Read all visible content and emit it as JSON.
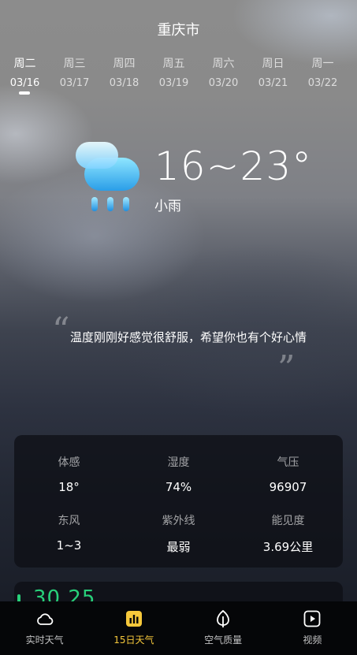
{
  "header": {
    "city": "重庆市"
  },
  "days": [
    {
      "weekday": "周二",
      "date": "03/16",
      "active": true
    },
    {
      "weekday": "周三",
      "date": "03/17"
    },
    {
      "weekday": "周四",
      "date": "03/18"
    },
    {
      "weekday": "周五",
      "date": "03/19"
    },
    {
      "weekday": "周六",
      "date": "03/20"
    },
    {
      "weekday": "周日",
      "date": "03/21"
    },
    {
      "weekday": "周一",
      "date": "03/22"
    }
  ],
  "weather": {
    "temp_range": "16~23°",
    "condition": "小雨",
    "icon": "light-rain-icon"
  },
  "quote": {
    "open": "“",
    "text": "温度刚刚好感觉很舒服，希望你也有个好心情",
    "close": "”"
  },
  "details": [
    {
      "label": "体感",
      "value": "18°"
    },
    {
      "label": "湿度",
      "value": "74%"
    },
    {
      "label": "气压",
      "value": "96907"
    },
    {
      "label": "东风",
      "value": "1~3"
    },
    {
      "label": "紫外线",
      "value": "最弱"
    },
    {
      "label": "能见度",
      "value": "3.69公里"
    }
  ],
  "aqi_card": {
    "value": "30.25"
  },
  "tabs": [
    {
      "label": "实时天气",
      "icon": "cloud-icon"
    },
    {
      "label": "15日天气",
      "icon": "bar-chart-icon",
      "active": true
    },
    {
      "label": "空气质量",
      "icon": "leaf-icon"
    },
    {
      "label": "视频",
      "icon": "play-icon"
    }
  ],
  "colors": {
    "accent": "#f6c83b",
    "aqi_green": "#28d07a",
    "tabbar_bg": "#050608"
  }
}
